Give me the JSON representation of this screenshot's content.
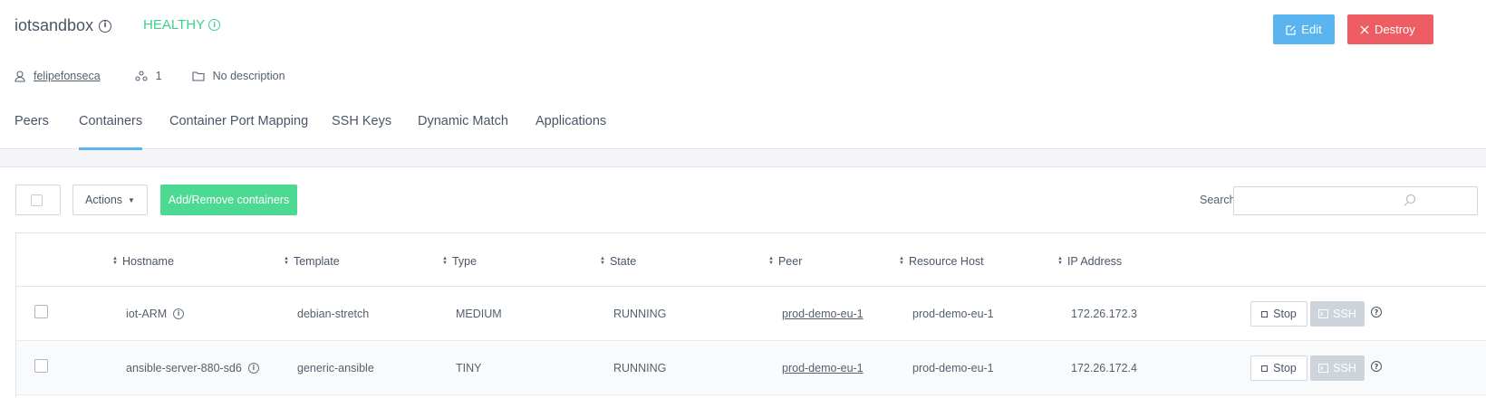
{
  "header": {
    "env_name": "iotsandbox",
    "status": "HEALTHY",
    "edit_label": "Edit",
    "destroy_label": "Destroy"
  },
  "meta": {
    "owner": "felipefonseca",
    "peer_count": "1",
    "description": "No description"
  },
  "tabs": [
    {
      "label": "Peers",
      "active": false
    },
    {
      "label": "Containers",
      "active": true
    },
    {
      "label": "Container Port Mapping",
      "active": false
    },
    {
      "label": "SSH Keys",
      "active": false
    },
    {
      "label": "Dynamic Match",
      "active": false
    },
    {
      "label": "Applications",
      "active": false
    }
  ],
  "toolbar": {
    "actions_label": "Actions",
    "add_remove_label": "Add/Remove containers",
    "search_label": "Search:",
    "search_value": ""
  },
  "table": {
    "columns": [
      "Hostname",
      "Template",
      "Type",
      "State",
      "Peer",
      "Resource Host",
      "IP Address"
    ],
    "rows": [
      {
        "hostname": "iot-ARM",
        "template": "debian-stretch",
        "type": "MEDIUM",
        "state": "RUNNING",
        "peer": "prod-demo-eu-1",
        "resource_host": "prod-demo-eu-1",
        "ip": "172.26.172.3",
        "stop_label": "Stop",
        "ssh_label": "SSH"
      },
      {
        "hostname": "ansible-server-880-sd6",
        "template": "generic-ansible",
        "type": "TINY",
        "state": "RUNNING",
        "peer": "prod-demo-eu-1",
        "resource_host": "prod-demo-eu-1",
        "ip": "172.26.172.4",
        "stop_label": "Stop",
        "ssh_label": "SSH"
      }
    ]
  },
  "colors": {
    "accent": "#5ab4f0",
    "healthy": "#3ecf8e",
    "destroy": "#ef5d64",
    "add_button": "#4cd991"
  },
  "icons": [
    "info-icon",
    "edit-icon",
    "close-icon",
    "user-icon",
    "peers-icon",
    "folder-icon",
    "caret-down-icon",
    "search-icon",
    "sort-icon",
    "stop-icon",
    "terminal-icon",
    "help-icon"
  ]
}
